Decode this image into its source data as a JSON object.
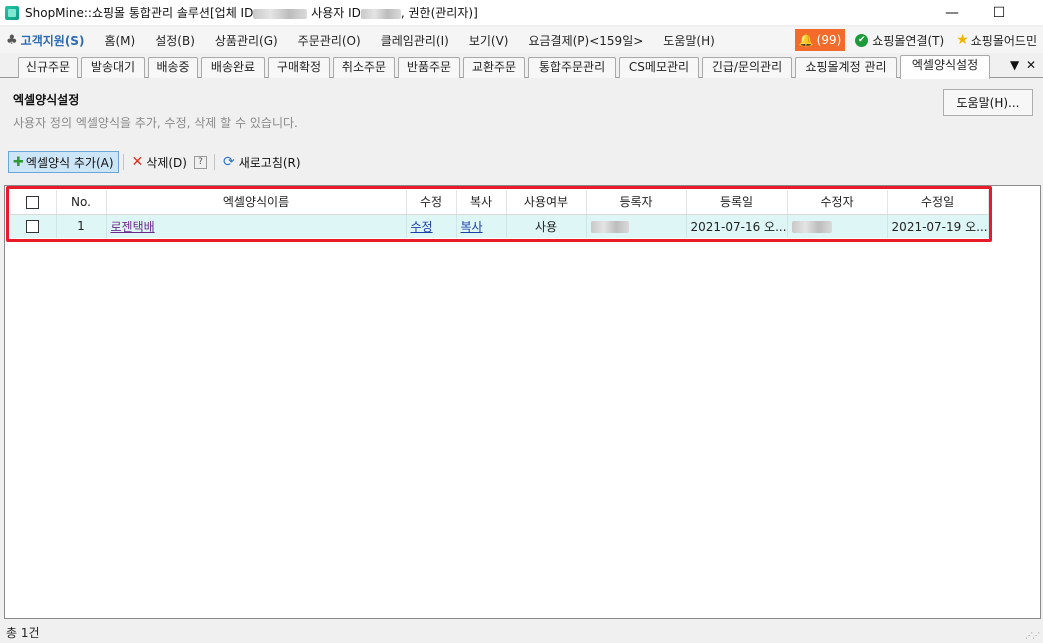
{
  "window": {
    "title_prefix": "ShopMine::쇼핑몰 통합관리 솔루션[업체 ID",
    "title_user": " 사용자 ID",
    "title_suffix": ", 권한(관리자)]",
    "minimize": "—",
    "maximize": "☐"
  },
  "menu": {
    "support": "고객지원(S)",
    "items": [
      "홈(M)",
      "설정(B)",
      "상품관리(G)",
      "주문관리(O)",
      "클레임관리(I)",
      "보기(V)",
      "요금결제(P)<159일>",
      "도움말(H)"
    ],
    "alert_count": "(99)",
    "shop_connect": "쇼핑몰연결(T)",
    "shop_add": "쇼핑몰어드민"
  },
  "tabs": [
    "신규주문",
    "발송대기",
    "배송중",
    "배송완료",
    "구매확정",
    "취소주문",
    "반품주문",
    "교환주문",
    "통합주문관리",
    "CS메모관리",
    "긴급/문의관리",
    "쇼핑몰계정 관리",
    "엑셀양식설정"
  ],
  "tab_controls": {
    "dropdown": "▼",
    "close": "✕"
  },
  "header": {
    "title": "엑셀양식설정",
    "description": "사용자 정의 엑셀양식을 추가, 수정, 삭제 할 수 있습니다.",
    "help_button": "도움말(H)..."
  },
  "toolbar": {
    "add": "엑셀양식 추가(A)",
    "delete": "삭제(D)",
    "help_q": "?",
    "refresh": "새로고침(R)"
  },
  "grid": {
    "columns": [
      "No.",
      "엑셀양식이름",
      "수정",
      "복사",
      "사용여부",
      "등록자",
      "등록일",
      "수정자",
      "수정일"
    ],
    "rows": [
      {
        "no": "1",
        "name": "로젠택배",
        "edit": "수정",
        "copy": "복사",
        "use": "사용",
        "created_by": "",
        "created_at": "2021-07-16 오...",
        "modified_by": "",
        "modified_at": "2021-07-19 오..."
      }
    ]
  },
  "status": {
    "total": "총 1건"
  },
  "colors": {
    "highlight": "#e81b2b",
    "row_bg": "#dff6f6",
    "link": "#1a3fa8",
    "alert_bg": "#f26b2a"
  }
}
